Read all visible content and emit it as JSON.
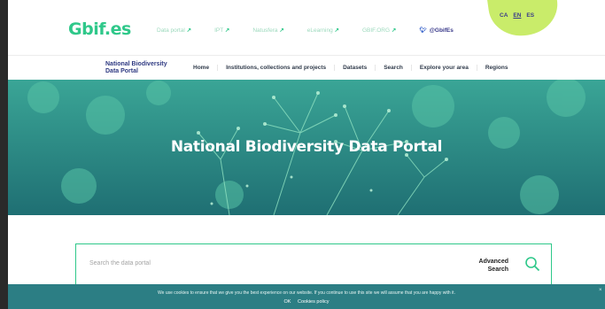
{
  "header": {
    "logo": "Gbif.es",
    "links": [
      {
        "label": "Data portal",
        "icon": "external-arrow-icon"
      },
      {
        "label": "IPT",
        "icon": "external-arrow-icon"
      },
      {
        "label": "Natusfera",
        "icon": "external-arrow-icon"
      },
      {
        "label": "eLearning",
        "icon": "external-arrow-icon"
      },
      {
        "label": "GBIF.ORG",
        "icon": "external-arrow-icon"
      }
    ],
    "twitter": "@GbifEs",
    "languages": [
      "CA",
      "EN",
      "ES"
    ],
    "active_language": "EN"
  },
  "nav": {
    "brand_line1": "National Biodiversity",
    "brand_line2": "Data Portal",
    "items": [
      "Home",
      "Institutions, collections and projects",
      "Datasets",
      "Search",
      "Explore your area",
      "Regions"
    ]
  },
  "hero": {
    "title": "National Biodiversity Data Portal"
  },
  "search": {
    "placeholder": "Search the data portal",
    "advanced_line1": "Advanced",
    "advanced_line2": "Search"
  },
  "cookie": {
    "text": "We use cookies to ensure that we give you the best experience on our website. If you continue to use this site we will assume that you are happy with it.",
    "ok_label": "OK",
    "policy_label": "Cookies policy",
    "close_label": "×"
  },
  "colors": {
    "brand_green": "#2fc88a",
    "lang_blob": "#c9ec6a",
    "hero_teal": "#2a8f86",
    "cookie_bar": "#2c7e84",
    "nav_text": "#2f3a82"
  }
}
